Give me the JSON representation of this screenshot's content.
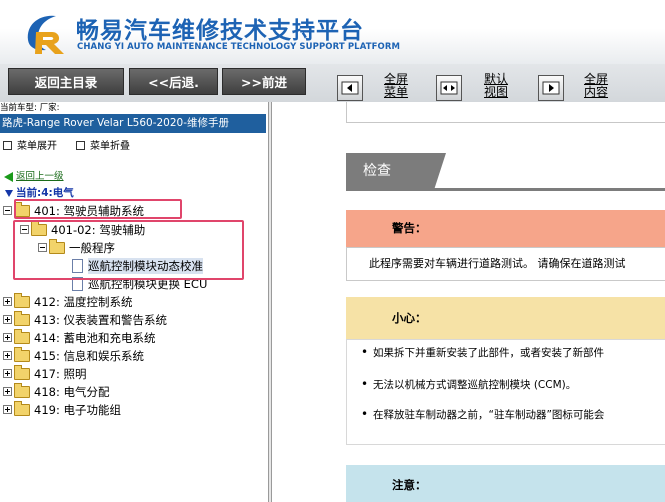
{
  "header": {
    "title": "畅易汽车维修技术支持平台",
    "subtitle": "CHANG YI AUTO MAINTENANCE TECHNOLOGY SUPPORT PLATFORM",
    "logo_icon": "cy-logo-icon",
    "brand_color": "#1d63b4"
  },
  "toolbar": {
    "back_main": "返回主目录",
    "prev": "<<后退.",
    "next": ">>前进",
    "fullscreen": [
      "全屏",
      "菜单"
    ],
    "default_view": [
      "默认",
      "视图"
    ],
    "full_content": [
      "全屏",
      "内容"
    ]
  },
  "left": {
    "model_line": "当前车型:   厂家:",
    "manual_title": "路虎-Range Rover Velar L560-2020-维修手册",
    "expand_menu": "菜单展开",
    "collapse_menu": "菜单折叠",
    "back_up": "返回上一级",
    "current": "当前:4:电气",
    "tree": [
      {
        "label": "401: 驾驶员辅助系统",
        "type": "folder",
        "expanded": true
      },
      {
        "label": "401-02: 驾驶辅助",
        "type": "folder",
        "expanded": true
      },
      {
        "label": "一般程序",
        "type": "folder",
        "expanded": true
      },
      {
        "label": "巡航控制模块动态校准",
        "type": "doc",
        "selected": true
      },
      {
        "label": "巡航控制模块更换 ECU",
        "type": "doc"
      },
      {
        "label": "412: 温度控制系统",
        "type": "folder"
      },
      {
        "label": "413: 仪表装置和警告系统",
        "type": "folder"
      },
      {
        "label": "414: 蓄电池和充电系统",
        "type": "folder"
      },
      {
        "label": "415: 信息和娱乐系统",
        "type": "folder"
      },
      {
        "label": "417: 照明",
        "type": "folder"
      },
      {
        "label": "418: 电气分配",
        "type": "folder"
      },
      {
        "label": "419: 电子功能组",
        "type": "folder"
      }
    ]
  },
  "content": {
    "section_title": "检查",
    "warning_title": "警告：",
    "warning_text": "此程序需要对车辆进行道路测试。 请确保在道路测试",
    "caution_title": "小心：",
    "caution_items": [
      "如果拆下并重新安装了此部件，或者安装了新部件",
      "无法以机械方式调整巡航控制模块 (CCM)。",
      "在释放驻车制动器之前，“驻车制动器”图标可能会"
    ],
    "note_title": "注意："
  },
  "colors": {
    "manual_bar": "#1f5f9e",
    "warning": "#f6a58a",
    "caution": "#f6e2a6",
    "note": "#c5e3ec",
    "section_tab": "#7c7c7c",
    "annotation_box": "#e0456b"
  }
}
